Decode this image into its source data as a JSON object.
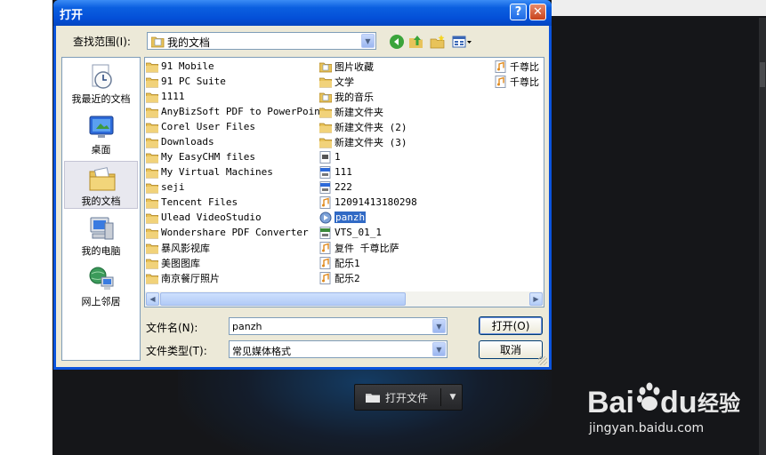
{
  "dialog": {
    "title": "打开",
    "help_label": "?",
    "close_label": "✕",
    "look_in_label": "查找范围(I):",
    "look_in_value": "我的文档",
    "filename_label": "文件名(N):",
    "filename_value": "panzh",
    "filetype_label": "文件类型(T):",
    "filetype_value": "常见媒体格式",
    "open_button": "打开(O)",
    "cancel_button": "取消"
  },
  "places": [
    {
      "label": "我最近的文档",
      "icon": "recent-documents-icon"
    },
    {
      "label": "桌面",
      "icon": "desktop-icon"
    },
    {
      "label": "我的文档",
      "icon": "my-documents-icon"
    },
    {
      "label": "我的电脑",
      "icon": "my-computer-icon"
    },
    {
      "label": "网上邻居",
      "icon": "network-places-icon"
    }
  ],
  "files": {
    "col1": [
      {
        "name": "91 Mobile",
        "type": "folder"
      },
      {
        "name": "91 PC Suite",
        "type": "folder"
      },
      {
        "name": "1111",
        "type": "folder"
      },
      {
        "name": "AnyBizSoft PDF to PowerPoint",
        "type": "folder"
      },
      {
        "name": "Corel User Files",
        "type": "folder"
      },
      {
        "name": "Downloads",
        "type": "folder"
      },
      {
        "name": "My EasyCHM files",
        "type": "folder"
      },
      {
        "name": "My Virtual Machines",
        "type": "folder"
      },
      {
        "name": "seji",
        "type": "folder"
      },
      {
        "name": "Tencent Files",
        "type": "folder"
      },
      {
        "name": "Ulead VideoStudio",
        "type": "folder"
      },
      {
        "name": "Wondershare PDF Converter",
        "type": "folder"
      },
      {
        "name": "暴风影视库",
        "type": "folder"
      },
      {
        "name": "美图图库",
        "type": "folder"
      },
      {
        "name": "南京餐厅照片",
        "type": "folder"
      }
    ],
    "col2": [
      {
        "name": "图片收藏",
        "type": "special-folder"
      },
      {
        "name": "文学",
        "type": "folder"
      },
      {
        "name": "我的音乐",
        "type": "special-folder"
      },
      {
        "name": "新建文件夹",
        "type": "folder"
      },
      {
        "name": "新建文件夹 (2)",
        "type": "folder"
      },
      {
        "name": "新建文件夹 (3)",
        "type": "folder"
      },
      {
        "name": "1",
        "type": "video"
      },
      {
        "name": "111",
        "type": "mpeg"
      },
      {
        "name": "222",
        "type": "mpeg"
      },
      {
        "name": "12091413180298",
        "type": "audio"
      },
      {
        "name": "panzh",
        "type": "media",
        "selected": true
      },
      {
        "name": "VTS_01_1",
        "type": "vob"
      },
      {
        "name": "复件 千尊比萨",
        "type": "audio"
      },
      {
        "name": "配乐1",
        "type": "audio"
      },
      {
        "name": "配乐2",
        "type": "audio"
      }
    ],
    "col3": [
      {
        "name": "千尊比",
        "type": "audio"
      },
      {
        "name": "千尊比",
        "type": "audio"
      }
    ]
  },
  "background": {
    "open_file_button": "打开文件",
    "watermark_brand_a": "Bai",
    "watermark_brand_b": "du",
    "watermark_brand_c": "经验",
    "watermark_url": "jingyan.baidu.com"
  },
  "colors": {
    "title_bar": "#0450d8",
    "dialog_face": "#ece9d8",
    "selection": "#316ac5",
    "page_bg": "#151619"
  }
}
